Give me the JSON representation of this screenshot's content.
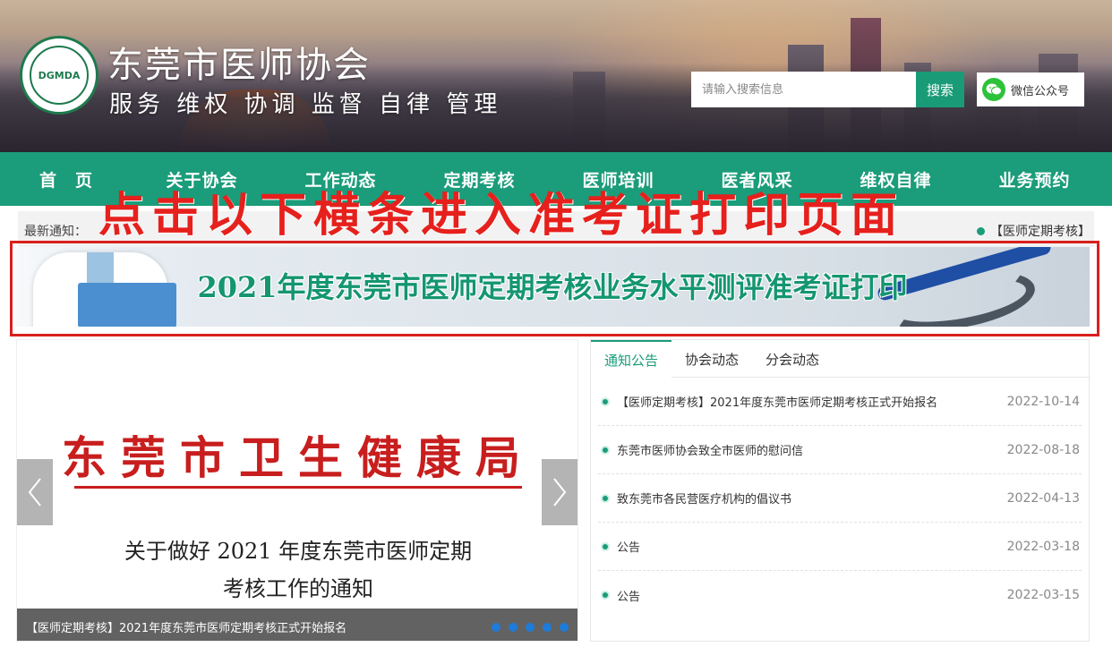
{
  "header": {
    "logo_text": "DGMDA",
    "title": "东莞市医师协会",
    "slogan": "服务 维权 协调 监督 自律 管理",
    "search": {
      "placeholder": "请输入搜索信息",
      "button": "搜索"
    },
    "wechat_label": "微信公众号"
  },
  "nav": {
    "items": [
      "首　页",
      "关于协会",
      "工作动态",
      "定期考核",
      "医师培训",
      "医者风采",
      "维权自律",
      "业务预约"
    ]
  },
  "notice": {
    "label": "最新通知：",
    "item": "【医师定期考核】"
  },
  "overlay_text": "点击以下横条进入准考证打印页面",
  "banner": {
    "title": "2021年度东莞市医师定期考核业务水平测评准考证打印"
  },
  "slider": {
    "org": "东莞市卫生健康局",
    "doc_title_line1": "关于做好 2021 年度东莞市医师定期",
    "doc_title_line2": "考核工作的通知",
    "caption": "【医师定期考核】2021年度东莞市医师定期考核正式开始报名"
  },
  "news": {
    "tabs": [
      "通知公告",
      "协会动态",
      "分会动态"
    ],
    "items": [
      {
        "title": "【医师定期考核】2021年度东莞市医师定期考核正式开始报名",
        "date": "2022-10-14"
      },
      {
        "title": "东莞市医师协会致全市医师的慰问信",
        "date": "2022-08-18"
      },
      {
        "title": "致东莞市各民营医疗机构的倡议书",
        "date": "2022-04-13"
      },
      {
        "title": "公告",
        "date": "2022-03-18"
      },
      {
        "title": "公告",
        "date": "2022-03-15"
      }
    ]
  },
  "colors": {
    "brand_green": "#1b9c7a",
    "highlight_red": "#d9201c",
    "slider_dot_blue": "#1e7bd9"
  }
}
